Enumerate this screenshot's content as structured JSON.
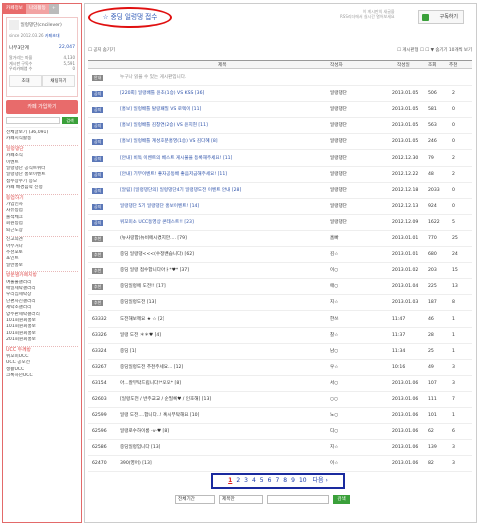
{
  "sidebar": {
    "tabs": [
      "카페정보",
      "나의활동",
      "+"
    ],
    "cafe_name": "일렁댕단(cncilever)",
    "since": "since 2012.03.26",
    "invite": "카페초대",
    "rank_label": "나무3단계",
    "member_count": "22,047",
    "stats": [
      {
        "label": "알거리는 마을",
        "value": "4,130"
      },
      {
        "label": "게시판 구독수",
        "value": "5,591"
      },
      {
        "label": "우리카페앱 수",
        "value": "0"
      }
    ],
    "btn_invite": "초대",
    "btn_chat": "채팅하기",
    "join_label": "카페 가입하기",
    "search_btn": "검색",
    "menu_top": [
      "전체글보기 (36,091)",
      "카페지식활동"
    ],
    "groups": [
      {
        "head": "일렁댕단",
        "items": [
          "카페소식",
          "이벤트",
          "일렁댕단 공식트위터",
          "일렁댕단 홍보이벤트",
          "접수장수기 응모",
          "카페 배경음악 신청"
        ]
      },
      {
        "head": "등업하기",
        "items": [
          "가입인사",
          "자유등업",
          "출석체크",
          "회원등업",
          "퇴근도장"
        ]
      },
      {
        "head": "",
        "items": [
          "신고의견",
          "아무거나",
          "추천포토",
          "포인트",
          "일반홍보"
        ]
      },
      {
        "head": "방문별카페지방",
        "items": [
          "여울물갤러리",
          "매일세탁갤러리",
          "우리집세탁장",
          "단편사진갤러리",
          "세탁소갤러리",
          "양주판세탁갤러리",
          "101회원회홍보",
          "101회원회홍보",
          "101회원회홍보",
          "201회원회홍보"
        ]
      },
      {
        "head": "UCC 두께방",
        "items": [
          "위꼬미UCC",
          "UCC 공모전",
          "생활UCC",
          "크록하던UCC"
        ]
      }
    ]
  },
  "header": {
    "title": "☆ 중딩 일렁댕 접수",
    "info_line1": "이 게시판의 새글을",
    "info_line2": "RSS리더에서 실시간 열어보세요",
    "subscribe": "구독하기"
  },
  "tools": {
    "left": "☐ 공지 숨기기",
    "right": "☐ 게시판형  ☐  ☐  ▼ 숨기기  10개씩 보기"
  },
  "table": {
    "columns": [
      "제목",
      "작성자",
      "작성일",
      "조회",
      "추천"
    ],
    "rows": [
      {
        "no": "안내",
        "subject": "누구나 읽을 수 있는 게시판입니다.",
        "author": "",
        "date": "",
        "views": "",
        "rec": "",
        "style": "gray"
      },
      {
        "no": "공지",
        "subject": "[220회] 일렁배틀 윤초(1승) VS KSS [36]",
        "author": "일렁댕단",
        "date": "2013.01.05",
        "views": "506",
        "rec": "2",
        "style": "blue"
      },
      {
        "no": "공지",
        "subject": "[홍보] 일렁배틀 탈랑패밀 VS 로렉이 [11]",
        "author": "일렁댕단",
        "date": "2013.01.05",
        "views": "581",
        "rec": "0",
        "style": "blue"
      },
      {
        "no": "공지",
        "subject": "[홍보] 일렁배틀 김창연(2승) VS 윤지현 [11]",
        "author": "일렁댕단",
        "date": "2013.01.05",
        "views": "563",
        "rec": "0",
        "style": "blue"
      },
      {
        "no": "공지",
        "subject": "[홍보] 일렁배틀 계성호분홍영(1승) VS 김다혜 [8]",
        "author": "일렁댕단",
        "date": "2013.01.05",
        "views": "246",
        "rec": "0",
        "style": "blue"
      },
      {
        "no": "공지",
        "subject": "[안내] 비독 이벤트의 베스트 게시물을 등록해주세요! [11]",
        "author": "일렁댕단",
        "date": "2012.12.30",
        "views": "79",
        "rec": "2",
        "style": "blue"
      },
      {
        "no": "공지",
        "subject": "[안내] 기부이벤트! 좋자공동배 좋음저금해주세요! [11]",
        "author": "일렁댕단",
        "date": "2012.12.22",
        "views": "48",
        "rec": "2",
        "style": "blue"
      },
      {
        "no": "공지",
        "subject": "[알림] [일렁댕단의] 일렁댕단4기 일렁댕도전 이벤트 안내 [28]",
        "author": "일렁댕단",
        "date": "2012.12.18",
        "views": "2033",
        "rec": "0",
        "style": "blue"
      },
      {
        "no": "공지",
        "subject": "일렁댕단 5기 일렁댕단 홍보이벤트! [14]",
        "author": "일렁댕단",
        "date": "2012.12.13",
        "views": "924",
        "rec": "0",
        "style": "blue"
      },
      {
        "no": "공지",
        "subject": "위꼬미소 UCC동영상 콘테스트!! [23]",
        "author": "일렁댕단",
        "date": "2012.12.09",
        "views": "1622",
        "rec": "5",
        "style": "blue"
      },
      {
        "no": "추천",
        "subject": "(뉴사랑합)뉴비에시켰지만.... [79]",
        "author": "홈빠",
        "date": "2013.01.01",
        "views": "770",
        "rec": "25",
        "style": "link"
      },
      {
        "no": "추천",
        "subject": "중딩 일렁댕<<<(수정밴습니다) [62]",
        "author": "김☆",
        "date": "2013.01.01",
        "views": "680",
        "rec": "24",
        "style": "link"
      },
      {
        "no": "추천",
        "subject": "중딩 일렁 접수합니다아ㅏ*♥* [37]",
        "author": "이○",
        "date": "2013.01.02",
        "views": "203",
        "rec": "15",
        "style": "link"
      },
      {
        "no": "추천",
        "subject": "중딩일렁에 도전!! [17]",
        "author": "애○",
        "date": "2013.01.04",
        "views": "225",
        "rec": "13",
        "style": "link"
      },
      {
        "no": "추천",
        "subject": "중딩일렁도전 [13]",
        "author": "지☆",
        "date": "2013.01.03",
        "views": "187",
        "rec": "8",
        "style": "link"
      },
      {
        "no": "63332",
        "subject": "도전해보께요 ★ ☆ [2]",
        "author": "한쓰",
        "date": "11:47",
        "views": "46",
        "rec": "1",
        "style": "link"
      },
      {
        "no": "63326",
        "subject": "일렁 도전 ＊＊♥ [4]",
        "author": "찰☆",
        "date": "11:37",
        "views": "28",
        "rec": "1",
        "style": "link"
      },
      {
        "no": "63324",
        "subject": "중딩 [1]",
        "author": "남○",
        "date": "11:34",
        "views": "25",
        "rec": "1",
        "style": "link"
      },
      {
        "no": "63267",
        "subject": "중딩일렁도전 추천주세요... [12]",
        "author": "우☆",
        "date": "10:16",
        "views": "49",
        "rec": "3",
        "style": "link"
      },
      {
        "no": "63154",
        "subject": "아...잘부탁드립니다!*오오* [8]",
        "author": "서○",
        "date": "2013.01.06",
        "views": "107",
        "rec": "3",
        "style": "link"
      },
      {
        "no": "62603",
        "subject": "[일렁도전 / 반주교교 / 순필록♥ / 인호해] [13]",
        "author": "○○",
        "date": "2013.01.06",
        "views": "111",
        "rec": "7",
        "style": "link"
      },
      {
        "no": "62599",
        "subject": "일렁 도전....합니다..! 혹시부탁해요 [10]",
        "author": "노○",
        "date": "2013.01.06",
        "views": "101",
        "rec": "1",
        "style": "link"
      },
      {
        "no": "62596",
        "subject": "일렁로수하이롱 -v-♥ [8]",
        "author": "디○",
        "date": "2013.01.06",
        "views": "62",
        "rec": "6",
        "style": "link"
      },
      {
        "no": "62586",
        "subject": "중딩일렁입니다 [13]",
        "author": "지☆",
        "date": "2013.01.06",
        "views": "139",
        "rec": "3",
        "style": "link"
      },
      {
        "no": "62470",
        "subject": "390(영어) [13]",
        "author": "이☆",
        "date": "2013.01.06",
        "views": "82",
        "rec": "3",
        "style": "link"
      }
    ]
  },
  "pager": {
    "pages": [
      "1",
      "2",
      "3",
      "4",
      "5",
      "6",
      "7",
      "8",
      "9",
      "10"
    ],
    "next": "다음 ›"
  },
  "bottom_search": {
    "period": "전체기간",
    "type": "제목만",
    "button": "검색"
  }
}
